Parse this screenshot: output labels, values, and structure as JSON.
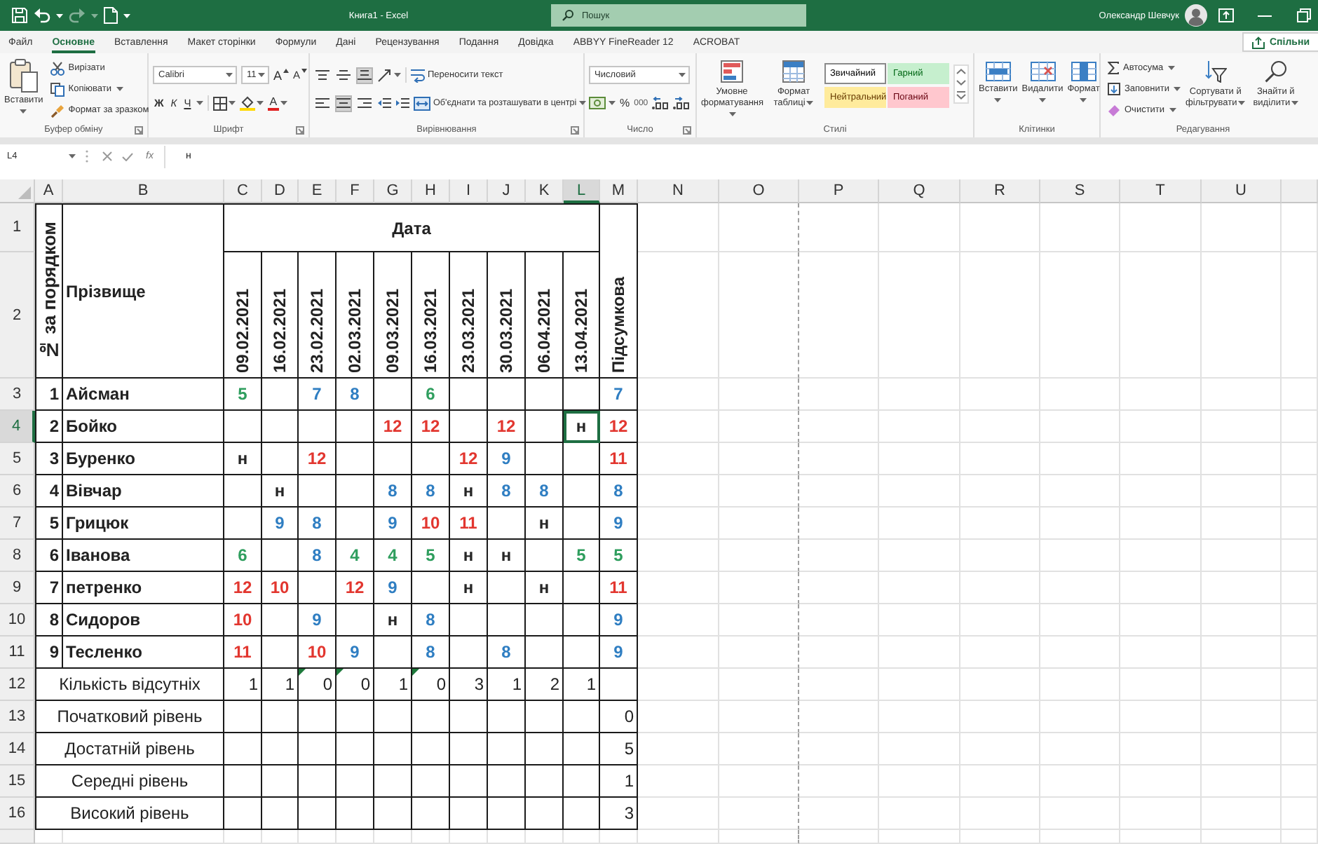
{
  "title_bar": {
    "quick_access": [
      {
        "kind": "save",
        "disabled": false
      },
      {
        "kind": "undo",
        "disabled": false
      },
      {
        "kind": "redo",
        "disabled": true
      },
      {
        "kind": "document",
        "disabled": false
      }
    ],
    "title": "Книга1 - Excel",
    "search": {
      "placeholder": "Пошук"
    },
    "user": "Олександр Шевчук"
  },
  "ribbon_tabs": [
    {
      "label": "Файл",
      "selected": false
    },
    {
      "label": "Основне",
      "selected": true
    },
    {
      "label": "Вставлення",
      "selected": false
    },
    {
      "label": "Макет сторінки",
      "selected": false
    },
    {
      "label": "Формули",
      "selected": false
    },
    {
      "label": "Дані",
      "selected": false
    },
    {
      "label": "Рецензування",
      "selected": false
    },
    {
      "label": "Подання",
      "selected": false
    },
    {
      "label": "Довідка",
      "selected": false
    },
    {
      "label": "ABBYY FineReader 12",
      "selected": false
    },
    {
      "label": "ACROBAT",
      "selected": false
    }
  ],
  "share_button": "Спільни",
  "ribbon": {
    "clipboard": {
      "label": "Буфер обміну",
      "paste": "Вставити",
      "cut": "Вирізати",
      "copy": "Копіювати",
      "format_painter": "Формат за зразком"
    },
    "font": {
      "label": "Шрифт",
      "font_name": "Calibri",
      "font_size": "11",
      "grow": "A",
      "shrink": "A",
      "bold": "Ж",
      "italic": "К",
      "underline": "Ч",
      "font_color": "A"
    },
    "alignment": {
      "label": "Вирівнювання",
      "align_buttons": [
        {
          "kind": "top",
          "on": false
        },
        {
          "kind": "middle",
          "on": false
        },
        {
          "kind": "bottom",
          "on": true
        },
        {
          "kind": "left",
          "on": false
        },
        {
          "kind": "center",
          "on": true
        },
        {
          "kind": "right",
          "on": false
        }
      ],
      "wrap_text": "Переносити текст",
      "merge": "Об'єднати та розташувати в центрі"
    },
    "number": {
      "label": "Число",
      "format": "Числовий",
      "percent": "%",
      "thousands": "000"
    },
    "styles": {
      "label": "Стилі",
      "conditional": "Умовне форматування",
      "format_table": "Формат таблиці",
      "cell_styles": [
        {
          "label": "Звичайний",
          "color": "#ffffff",
          "selected": true
        },
        {
          "label": "Гарний",
          "color": "#c6efce",
          "selected": false
        },
        {
          "label": "Нейтральний",
          "color": "#ffeb9c",
          "selected": false
        },
        {
          "label": "Поганий",
          "color": "#ffc7ce",
          "selected": false
        }
      ]
    },
    "cells": {
      "label": "Клітинки",
      "buttons": [
        {
          "kind": "insert",
          "label": "Вставити"
        },
        {
          "kind": "delete",
          "label": "Видалити"
        },
        {
          "kind": "format",
          "label": "Формат"
        }
      ]
    },
    "editing": {
      "label": "Редагування",
      "commands": [
        {
          "kind": "sum",
          "label": "Автосума"
        },
        {
          "kind": "fill",
          "label": "Заповнити"
        },
        {
          "kind": "clear",
          "label": "Очистити"
        }
      ],
      "sort": "Сортувати й фільтрувати",
      "find": "Знайти й виділити"
    }
  },
  "formula_bar": {
    "name_box": "L4",
    "function_label": "fx",
    "formula": "н"
  },
  "sheet": {
    "columns": [
      {
        "label": "A",
        "selected": false
      },
      {
        "label": "B",
        "selected": false
      },
      {
        "label": "C",
        "selected": false
      },
      {
        "label": "D",
        "selected": false
      },
      {
        "label": "E",
        "selected": false
      },
      {
        "label": "F",
        "selected": false
      },
      {
        "label": "G",
        "selected": false
      },
      {
        "label": "H",
        "selected": false
      },
      {
        "label": "I",
        "selected": false
      },
      {
        "label": "J",
        "selected": false
      },
      {
        "label": "K",
        "selected": false
      },
      {
        "label": "L",
        "selected": true
      },
      {
        "label": "M",
        "selected": false
      },
      {
        "label": "N",
        "selected": false
      },
      {
        "label": "O",
        "selected": false
      },
      {
        "label": "P",
        "selected": false
      },
      {
        "label": "Q",
        "selected": false
      },
      {
        "label": "R",
        "selected": false
      },
      {
        "label": "S",
        "selected": false
      },
      {
        "label": "T",
        "selected": false
      },
      {
        "label": "U",
        "selected": false
      }
    ],
    "rows": [
      {
        "label": "1",
        "selected": false
      },
      {
        "label": "2",
        "selected": false
      },
      {
        "label": "3",
        "selected": false
      },
      {
        "label": "4",
        "selected": true
      },
      {
        "label": "5",
        "selected": false
      },
      {
        "label": "6",
        "selected": false
      },
      {
        "label": "7",
        "selected": false
      },
      {
        "label": "8",
        "selected": false
      },
      {
        "label": "9",
        "selected": false
      },
      {
        "label": "10",
        "selected": false
      },
      {
        "label": "11",
        "selected": false
      },
      {
        "label": "12",
        "selected": false
      },
      {
        "label": "13",
        "selected": false
      },
      {
        "label": "14",
        "selected": false
      },
      {
        "label": "15",
        "selected": false
      },
      {
        "label": "16",
        "selected": false
      }
    ],
    "table": {
      "number_heading": "№ за порядком",
      "name_heading": "Прізвище",
      "date_heading": "Дата",
      "dates": [
        "09.02.2021",
        "16.02.2021",
        "23.02.2021",
        "02.03.2021",
        "09.03.2021",
        "16.03.2021",
        "23.03.2021",
        "30.03.2021",
        "06.04.2021",
        "13.04.2021"
      ],
      "final_heading": "Підсумкова",
      "students": [
        {
          "number": "1",
          "name": "Айсман",
          "marks": [
            {
              "kind": "mark",
              "text": "5",
              "color": "#2f9e5e",
              "selected": false
            },
            {
              "kind": "blank",
              "selected": false
            },
            {
              "kind": "mark",
              "text": "7",
              "color": "#2f7ec2",
              "selected": false
            },
            {
              "kind": "mark",
              "text": "8",
              "color": "#2f7ec2",
              "selected": false
            },
            {
              "kind": "blank",
              "selected": false
            },
            {
              "kind": "mark",
              "text": "6",
              "color": "#2f9e5e",
              "selected": false
            },
            {
              "kind": "blank",
              "selected": false
            },
            {
              "kind": "blank",
              "selected": false
            },
            {
              "kind": "blank",
              "selected": false
            },
            {
              "kind": "blank",
              "selected": false
            }
          ],
          "final": {
            "text": "7",
            "color": "#2f7ec2"
          }
        },
        {
          "number": "2",
          "name": "Бойко",
          "marks": [
            {
              "kind": "blank",
              "selected": false
            },
            {
              "kind": "blank",
              "selected": false
            },
            {
              "kind": "blank",
              "selected": false
            },
            {
              "kind": "blank",
              "selected": false
            },
            {
              "kind": "mark",
              "text": "12",
              "color": "#e2362f",
              "selected": false
            },
            {
              "kind": "mark",
              "text": "12",
              "color": "#e2362f",
              "selected": false
            },
            {
              "kind": "blank",
              "selected": false
            },
            {
              "kind": "mark",
              "text": "12",
              "color": "#e2362f",
              "selected": false
            },
            {
              "kind": "blank",
              "selected": false
            },
            {
              "kind": "mark",
              "text": "н",
              "color": "#262626",
              "selected": true
            }
          ],
          "final": {
            "text": "12",
            "color": "#e2362f"
          }
        },
        {
          "number": "3",
          "name": "Буренко",
          "marks": [
            {
              "kind": "mark",
              "text": "н",
              "color": "#262626",
              "selected": false
            },
            {
              "kind": "blank",
              "selected": false
            },
            {
              "kind": "mark",
              "text": "12",
              "color": "#e2362f",
              "selected": false
            },
            {
              "kind": "blank",
              "selected": false
            },
            {
              "kind": "blank",
              "selected": false
            },
            {
              "kind": "blank",
              "selected": false
            },
            {
              "kind": "mark",
              "text": "12",
              "color": "#e2362f",
              "selected": false
            },
            {
              "kind": "mark",
              "text": "9",
              "color": "#2f7ec2",
              "selected": false
            },
            {
              "kind": "blank",
              "selected": false
            },
            {
              "kind": "blank",
              "selected": false
            }
          ],
          "final": {
            "text": "11",
            "color": "#e2362f"
          }
        },
        {
          "number": "4",
          "name": "Вівчар",
          "marks": [
            {
              "kind": "blank",
              "selected": false
            },
            {
              "kind": "mark",
              "text": "н",
              "color": "#262626",
              "selected": false
            },
            {
              "kind": "blank",
              "selected": false
            },
            {
              "kind": "blank",
              "selected": false
            },
            {
              "kind": "mark",
              "text": "8",
              "color": "#2f7ec2",
              "selected": false
            },
            {
              "kind": "mark",
              "text": "8",
              "color": "#2f7ec2",
              "selected": false
            },
            {
              "kind": "mark",
              "text": "н",
              "color": "#262626",
              "selected": false
            },
            {
              "kind": "mark",
              "text": "8",
              "color": "#2f7ec2",
              "selected": false
            },
            {
              "kind": "mark",
              "text": "8",
              "color": "#2f7ec2",
              "selected": false
            },
            {
              "kind": "blank",
              "selected": false
            }
          ],
          "final": {
            "text": "8",
            "color": "#2f7ec2"
          }
        },
        {
          "number": "5",
          "name": "Грицюк",
          "marks": [
            {
              "kind": "blank",
              "selected": false
            },
            {
              "kind": "mark",
              "text": "9",
              "color": "#2f7ec2",
              "selected": false
            },
            {
              "kind": "mark",
              "text": "8",
              "color": "#2f7ec2",
              "selected": false
            },
            {
              "kind": "blank",
              "selected": false
            },
            {
              "kind": "mark",
              "text": "9",
              "color": "#2f7ec2",
              "selected": false
            },
            {
              "kind": "mark",
              "text": "10",
              "color": "#e2362f",
              "selected": false
            },
            {
              "kind": "mark",
              "text": "11",
              "color": "#e2362f",
              "selected": false
            },
            {
              "kind": "blank",
              "selected": false
            },
            {
              "kind": "mark",
              "text": "н",
              "color": "#262626",
              "selected": false
            },
            {
              "kind": "blank",
              "selected": false
            }
          ],
          "final": {
            "text": "9",
            "color": "#2f7ec2"
          }
        },
        {
          "number": "6",
          "name": "Іванова",
          "marks": [
            {
              "kind": "mark",
              "text": "6",
              "color": "#2f9e5e",
              "selected": false
            },
            {
              "kind": "blank",
              "selected": false
            },
            {
              "kind": "mark",
              "text": "8",
              "color": "#2f7ec2",
              "selected": false
            },
            {
              "kind": "mark",
              "text": "4",
              "color": "#2f9e5e",
              "selected": false
            },
            {
              "kind": "mark",
              "text": "4",
              "color": "#2f9e5e",
              "selected": false
            },
            {
              "kind": "mark",
              "text": "5",
              "color": "#2f9e5e",
              "selected": false
            },
            {
              "kind": "mark",
              "text": "н",
              "color": "#262626",
              "selected": false
            },
            {
              "kind": "mark",
              "text": "н",
              "color": "#262626",
              "selected": false
            },
            {
              "kind": "blank",
              "selected": false
            },
            {
              "kind": "mark",
              "text": "5",
              "color": "#2f9e5e",
              "selected": false
            }
          ],
          "final": {
            "text": "5",
            "color": "#2f9e5e"
          }
        },
        {
          "number": "7",
          "name": "петренко",
          "marks": [
            {
              "kind": "mark",
              "text": "12",
              "color": "#e2362f",
              "selected": false
            },
            {
              "kind": "mark",
              "text": "10",
              "color": "#e2362f",
              "selected": false
            },
            {
              "kind": "blank",
              "selected": false
            },
            {
              "kind": "mark",
              "text": "12",
              "color": "#e2362f",
              "selected": false
            },
            {
              "kind": "mark",
              "text": "9",
              "color": "#2f7ec2",
              "selected": false
            },
            {
              "kind": "blank",
              "selected": false
            },
            {
              "kind": "mark",
              "text": "н",
              "color": "#262626",
              "selected": false
            },
            {
              "kind": "blank",
              "selected": false
            },
            {
              "kind": "mark",
              "text": "н",
              "color": "#262626",
              "selected": false
            },
            {
              "kind": "blank",
              "selected": false
            }
          ],
          "final": {
            "text": "11",
            "color": "#e2362f"
          }
        },
        {
          "number": "8",
          "name": "Сидоров",
          "marks": [
            {
              "kind": "mark",
              "text": "10",
              "color": "#e2362f",
              "selected": false
            },
            {
              "kind": "blank",
              "selected": false
            },
            {
              "kind": "mark",
              "text": "9",
              "color": "#2f7ec2",
              "selected": false
            },
            {
              "kind": "blank",
              "selected": false
            },
            {
              "kind": "mark",
              "text": "н",
              "color": "#262626",
              "selected": false
            },
            {
              "kind": "mark",
              "text": "8",
              "color": "#2f7ec2",
              "selected": false
            },
            {
              "kind": "blank",
              "selected": false
            },
            {
              "kind": "blank",
              "selected": false
            },
            {
              "kind": "blank",
              "selected": false
            },
            {
              "kind": "blank",
              "selected": false
            }
          ],
          "final": {
            "text": "9",
            "color": "#2f7ec2"
          }
        },
        {
          "number": "9",
          "name": "Тесленко",
          "marks": [
            {
              "kind": "mark",
              "text": "11",
              "color": "#e2362f",
              "selected": false
            },
            {
              "kind": "blank",
              "selected": false
            },
            {
              "kind": "mark",
              "text": "10",
              "color": "#e2362f",
              "selected": false
            },
            {
              "kind": "mark",
              "text": "9",
              "color": "#2f7ec2",
              "selected": false
            },
            {
              "kind": "blank",
              "selected": false
            },
            {
              "kind": "mark",
              "text": "8",
              "color": "#2f7ec2",
              "selected": false
            },
            {
              "kind": "blank",
              "selected": false
            },
            {
              "kind": "mark",
              "text": "8",
              "color": "#2f7ec2",
              "selected": false
            },
            {
              "kind": "blank",
              "selected": false
            },
            {
              "kind": "blank",
              "selected": false
            }
          ],
          "final": {
            "text": "9",
            "color": "#2f7ec2"
          }
        }
      ],
      "absences": {
        "label": "Кількість відсутніх",
        "counts": [
          {
            "text": "1",
            "flagged": false
          },
          {
            "text": "1",
            "flagged": false
          },
          {
            "text": "0",
            "flagged": true
          },
          {
            "text": "0",
            "flagged": true
          },
          {
            "text": "1",
            "flagged": false
          },
          {
            "text": "0",
            "flagged": true
          },
          {
            "text": "3",
            "flagged": false
          },
          {
            "text": "1",
            "flagged": false
          },
          {
            "text": "2",
            "flagged": false
          },
          {
            "text": "1",
            "flagged": false
          }
        ]
      },
      "levels": [
        {
          "label": "Початковий рівень",
          "count": "0"
        },
        {
          "label": "Достатній рівень",
          "count": "5"
        },
        {
          "label": "Середні рівень",
          "count": "1"
        },
        {
          "label": "Високий рівень",
          "count": "3"
        }
      ]
    }
  }
}
